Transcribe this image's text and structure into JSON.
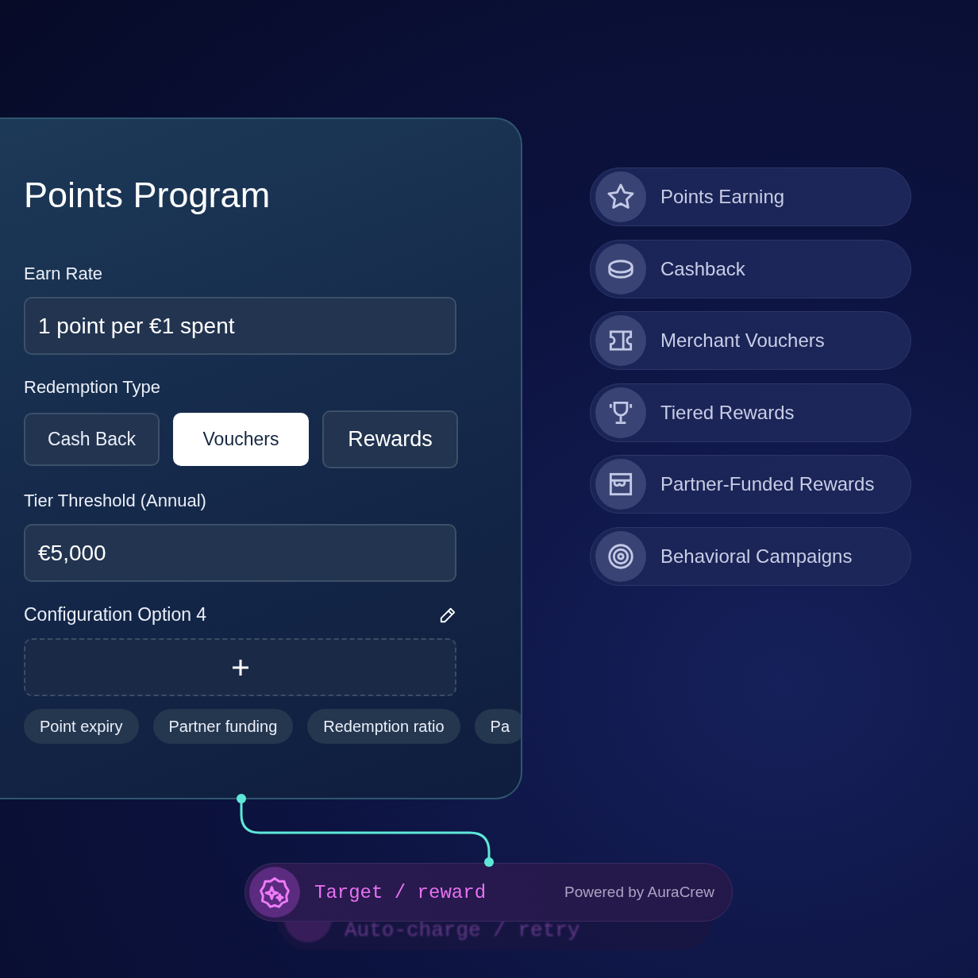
{
  "card": {
    "title": "Points Program",
    "earn_rate": {
      "label": "Earn Rate",
      "value": "1 point per €1 spent"
    },
    "redemption": {
      "label": "Redemption Type",
      "options": [
        {
          "label": "Cash Back",
          "selected": false,
          "hovered": false
        },
        {
          "label": "Vouchers",
          "selected": true,
          "hovered": false
        },
        {
          "label": "Rewards",
          "selected": false,
          "hovered": true
        }
      ]
    },
    "tier_threshold": {
      "label": "Tier Threshold (Annual)",
      "value": "€5,000"
    },
    "config": {
      "label": "Configuration Option 4",
      "chips": [
        "Point expiry",
        "Partner funding",
        "Redemption ratio",
        "Pa"
      ]
    }
  },
  "side_items": [
    {
      "label": "Points Earning"
    },
    {
      "label": "Cashback"
    },
    {
      "label": "Merchant Vouchers"
    },
    {
      "label": "Tiered Rewards"
    },
    {
      "label": "Partner-Funded Rewards"
    },
    {
      "label": "Behavioral Campaigns"
    }
  ],
  "bottom": {
    "label": "Target / reward",
    "powered_by": "Powered by AuraCrew",
    "behind_label": "Auto-charge / retry"
  }
}
